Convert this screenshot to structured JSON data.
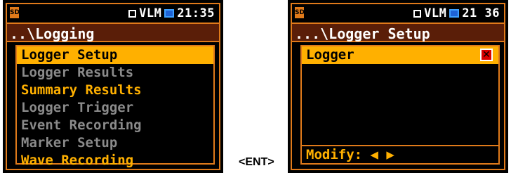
{
  "left_screen": {
    "sd_icon": "SD",
    "status_label": "VLM",
    "time": "21:35",
    "title": "..\\Logging",
    "items": [
      {
        "label": "Logger Setup",
        "style": "selected"
      },
      {
        "label": "Logger Results",
        "style": "gray"
      },
      {
        "label": "Summary Results",
        "style": "yellow"
      },
      {
        "label": "Logger Trigger",
        "style": "gray"
      },
      {
        "label": "Event Recording",
        "style": "gray"
      },
      {
        "label": "Marker Setup",
        "style": "gray"
      },
      {
        "label": "Wave Recording",
        "style": "yellow"
      }
    ]
  },
  "right_screen": {
    "sd_icon": "SD",
    "status_label": "VLM",
    "time": "21 36",
    "title": "...\\Logger Setup",
    "item_label": "Logger",
    "checkbox_icon": "x-icon",
    "modify_label": "Modify: ◀ ▶"
  },
  "key_hint": "<ENT>",
  "colors": {
    "accent": "#e07a1a",
    "highlight": "#ffb000",
    "title_bg": "#5a1e08",
    "disabled": "#8a8a8a"
  }
}
